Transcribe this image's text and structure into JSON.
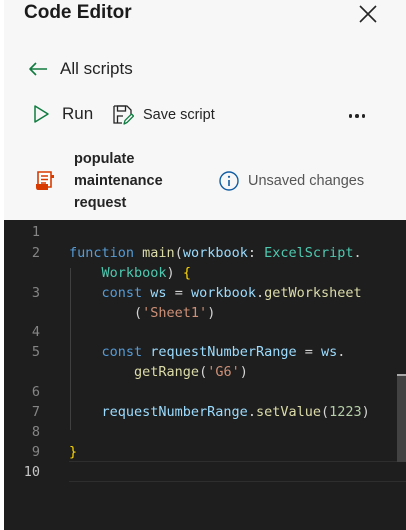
{
  "panel": {
    "title": "Code Editor",
    "close_icon": "close-icon"
  },
  "nav": {
    "back_label": "All scripts",
    "back_icon": "arrow-left-icon"
  },
  "toolbar": {
    "run_label": "Run",
    "run_icon": "play-icon",
    "save_label": "Save script",
    "save_icon": "save-icon",
    "more_icon": "more-horizontal-icon"
  },
  "script": {
    "name": "populate maintenance request",
    "name_lines": [
      "populate",
      "maintenance",
      "request"
    ],
    "icon": "script-file-icon",
    "status": "Unsaved changes",
    "status_icon": "info-icon"
  },
  "editor": {
    "line_numbers": [
      "1",
      "2",
      "3",
      "4",
      "5",
      "6",
      "7",
      "8",
      "9",
      "10"
    ],
    "active_line": "10",
    "code": [
      "",
      "function main(workbook: ExcelScript.Workbook) {",
      "    const ws = workbook.getWorksheet('Sheet1')",
      "",
      "    const requestNumberRange = ws.getRange('G6')",
      "",
      "    requestNumberRange.setValue(1223)",
      "",
      "}",
      ""
    ]
  },
  "colors": {
    "accent_green": "#107c41",
    "script_icon_orange": "#d83b01",
    "editor_bg": "#1e1e1e",
    "keyword": "#569cd6",
    "function": "#dcdcaa",
    "type": "#4ec9b0",
    "string": "#ce9178",
    "number": "#b5cea8"
  }
}
